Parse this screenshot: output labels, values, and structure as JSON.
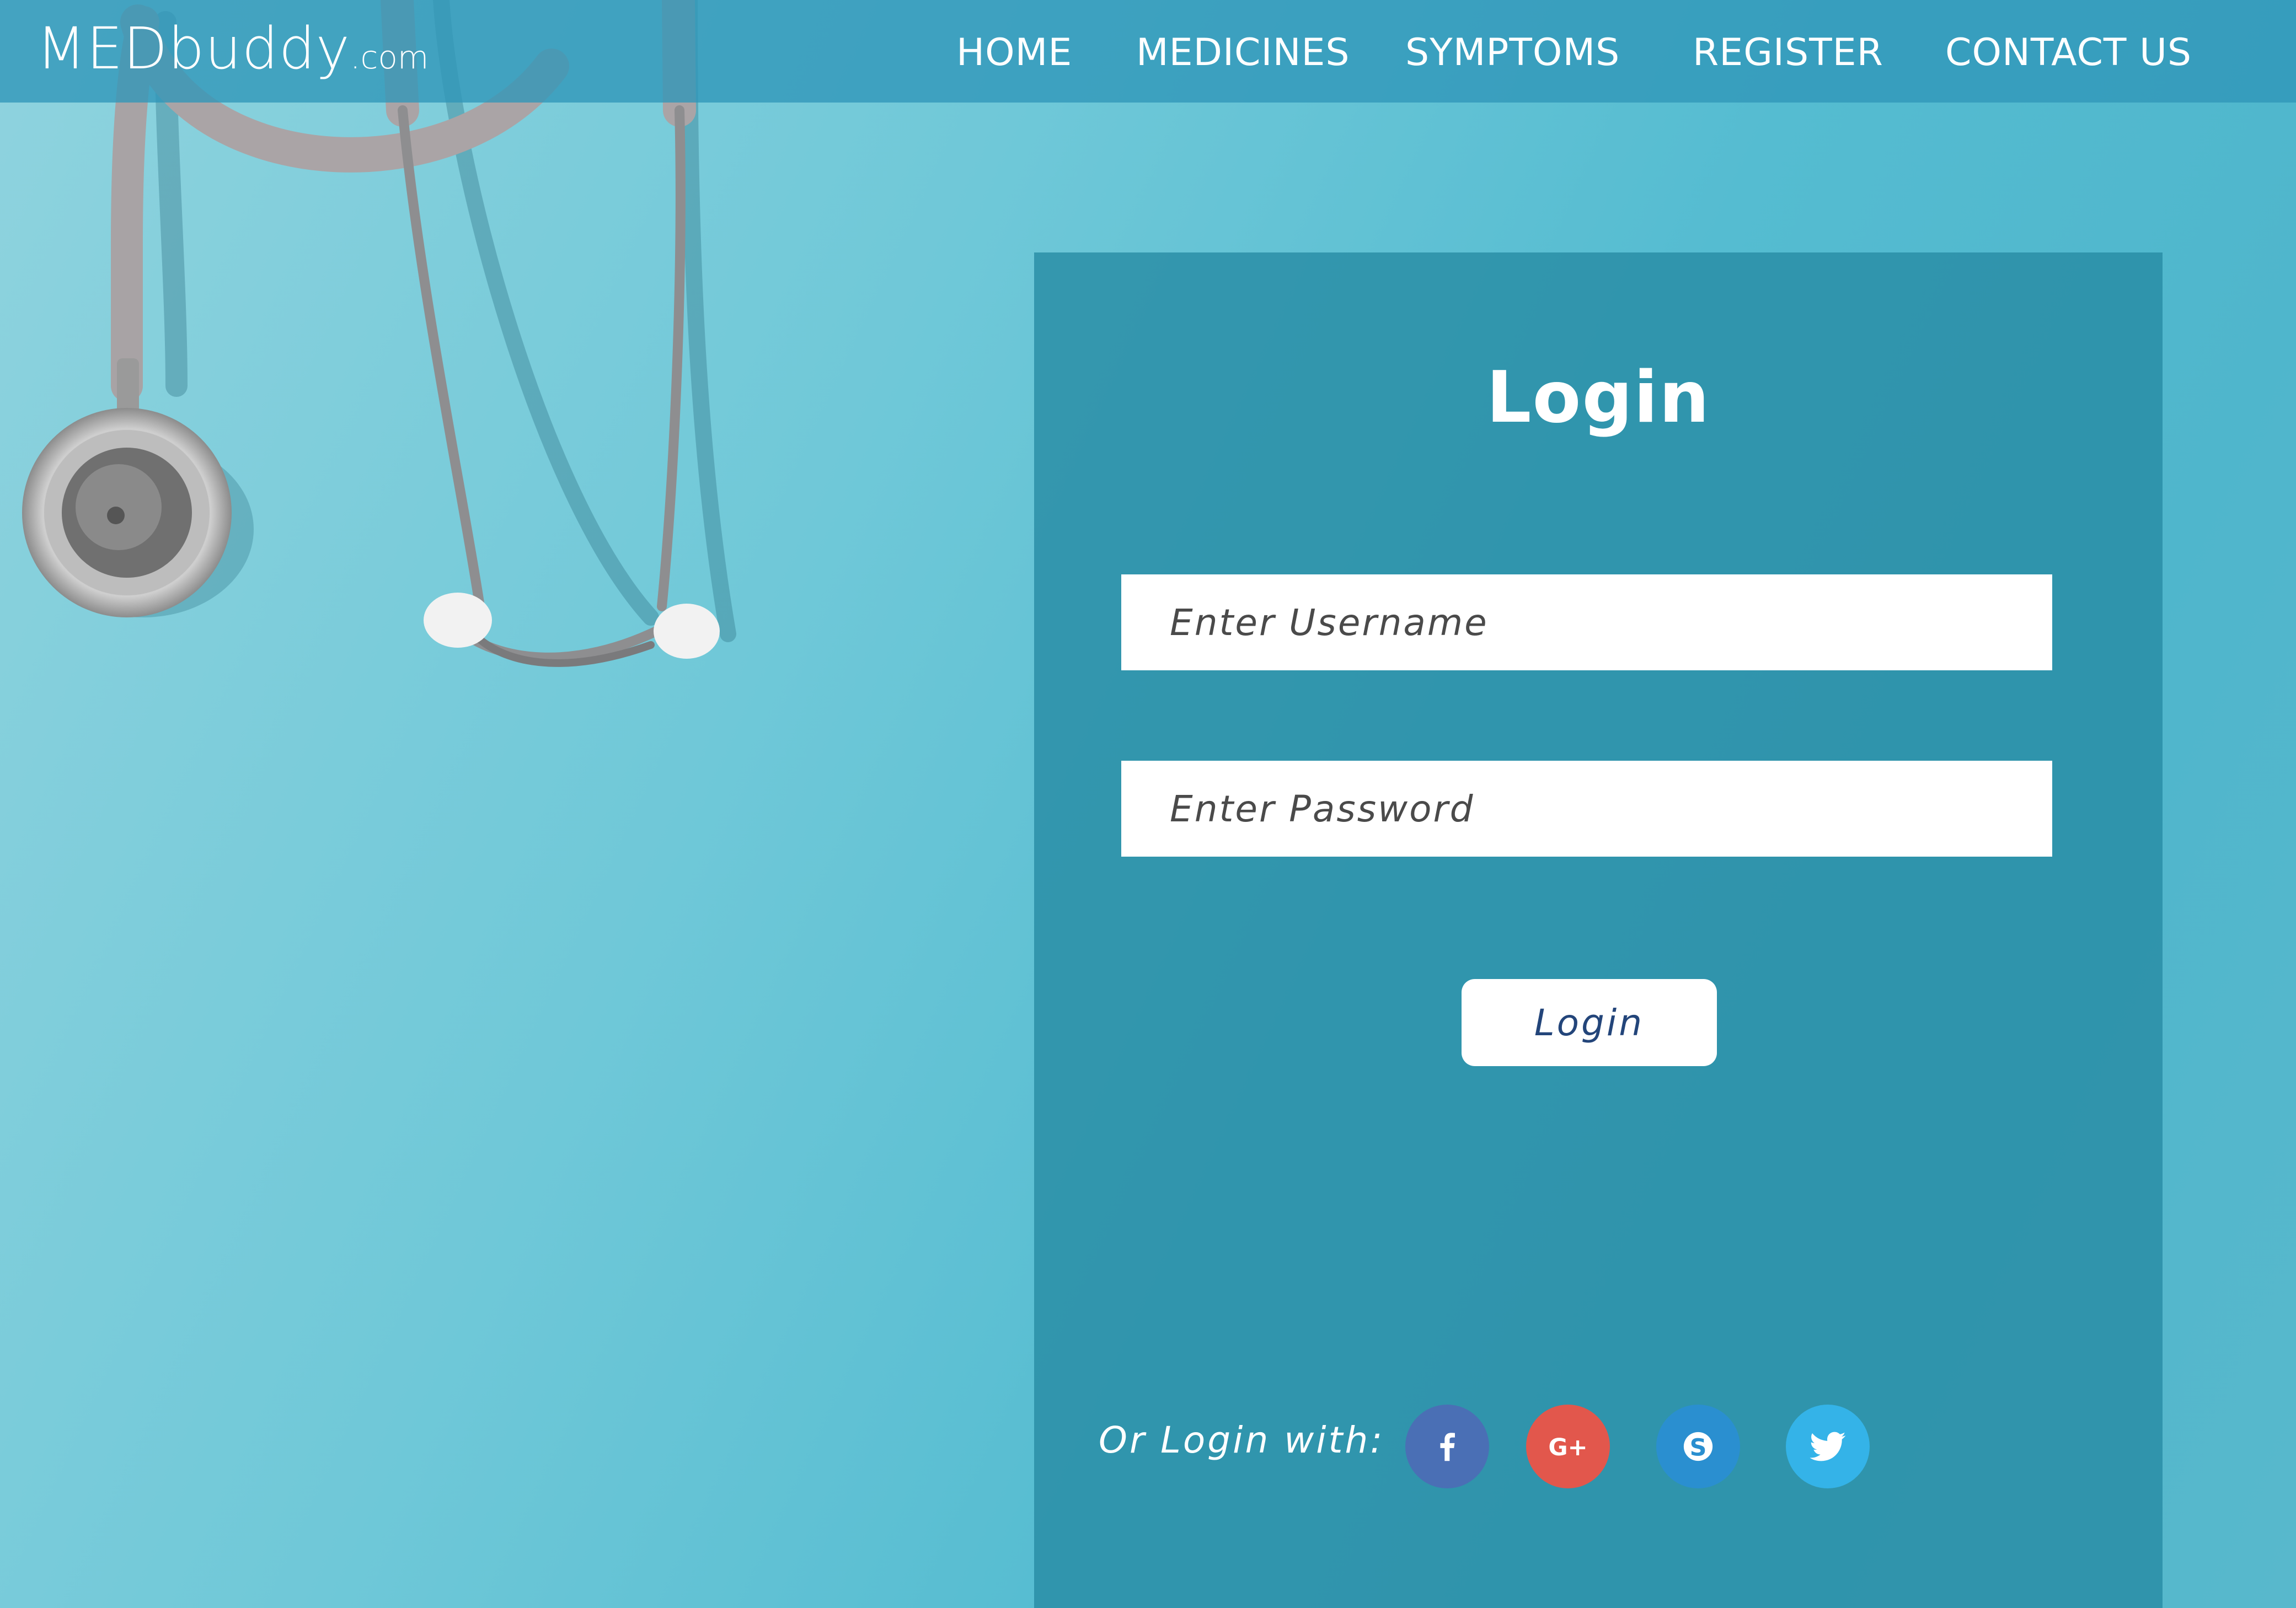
{
  "brand": {
    "name": "MEDbuddy",
    "suffix": ".com"
  },
  "nav": {
    "items": [
      {
        "label": "HOME"
      },
      {
        "label": "MEDICINES"
      },
      {
        "label": "SYMPTOMS"
      },
      {
        "label": "REGISTER"
      },
      {
        "label": "CONTACT US"
      }
    ]
  },
  "login": {
    "title": "Login",
    "username_placeholder": "Enter Username",
    "username_value": "",
    "password_placeholder": "Enter Password",
    "password_value": "",
    "button_label": "Login",
    "social_label": "Or Login with:",
    "social": [
      {
        "icon": "facebook-icon",
        "color": "#4a6fb5"
      },
      {
        "icon": "google-plus-icon",
        "color": "#e2574c"
      },
      {
        "icon": "skype-icon",
        "color": "#2a8fd0"
      },
      {
        "icon": "twitter-icon",
        "color": "#34b3e8"
      }
    ]
  },
  "colors": {
    "panel": "#2e94ad",
    "nav_bar": "#3a9bbd",
    "background": "#5cc0d3",
    "button_text": "#23457a"
  }
}
